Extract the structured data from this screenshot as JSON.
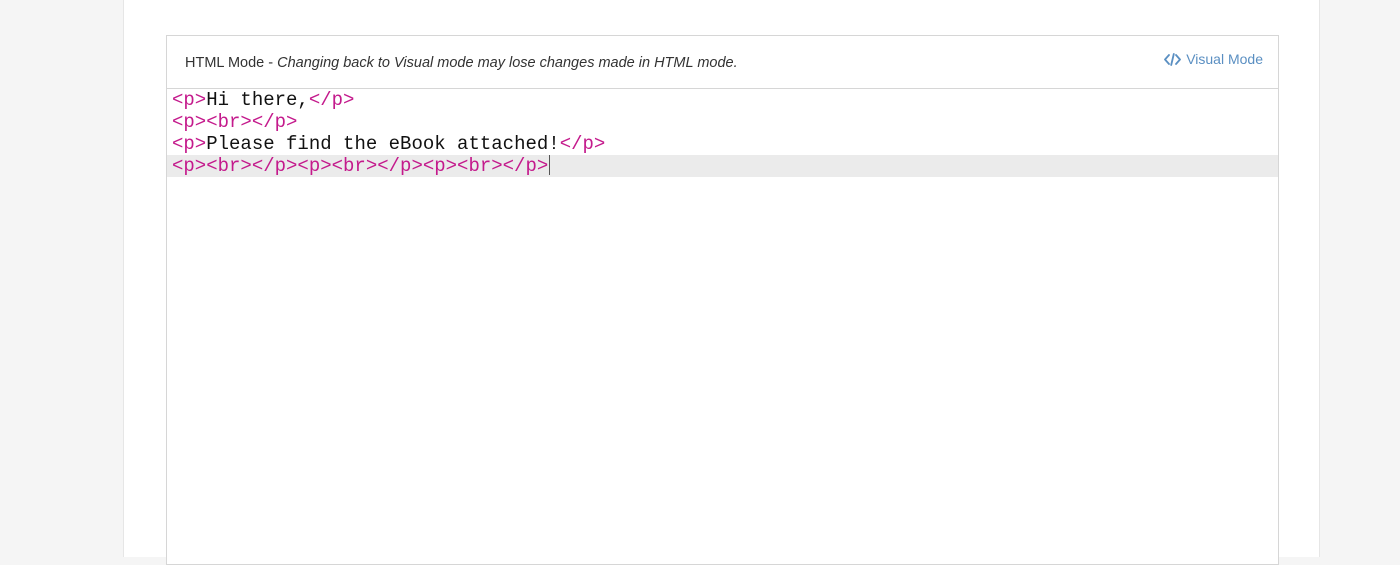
{
  "editor": {
    "mode_label": "HTML Mode - ",
    "mode_warning": "Changing back to Visual mode may lose changes made in HTML mode.",
    "visual_mode_button": {
      "icon": "code-icon",
      "label": "Visual Mode"
    },
    "code_lines": [
      [
        {
          "t": "tag",
          "v": "<p>"
        },
        {
          "t": "text",
          "v": "Hi there,"
        },
        {
          "t": "tag",
          "v": "</p>"
        }
      ],
      [
        {
          "t": "tag",
          "v": "<p><br></p>"
        }
      ],
      [
        {
          "t": "tag",
          "v": "<p>"
        },
        {
          "t": "text",
          "v": "Please find the eBook attached!"
        },
        {
          "t": "tag",
          "v": "</p>"
        }
      ],
      [
        {
          "t": "tag",
          "v": "<p><br></p><p><br></p><p><br></p>"
        }
      ]
    ],
    "active_line": 3
  },
  "colors": {
    "tag": "#c41a8c",
    "link_accent": "#5a8fc2",
    "active_line_bg": "#ebebeb"
  }
}
